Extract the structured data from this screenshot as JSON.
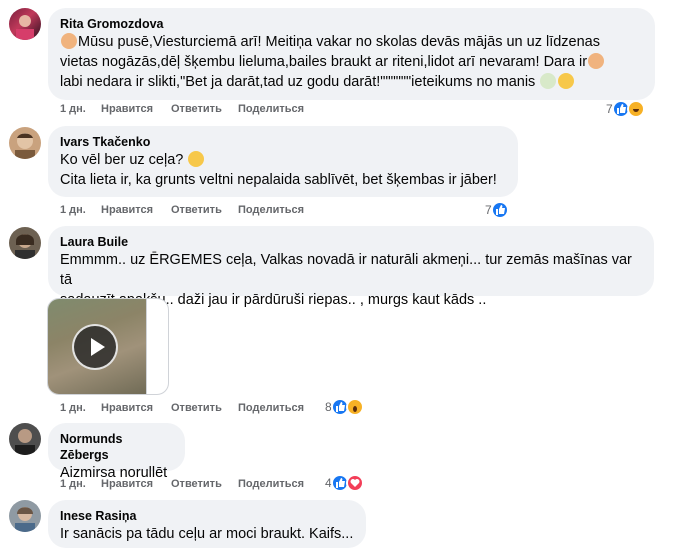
{
  "comments": [
    {
      "author": "Rita Gromozdova",
      "lines": [
        "Mūsu pusē,Viesturciemā arī! Meitiņa vakar no skolas devās mājās un uz līdzenas",
        "vietas nogāzās,dēļ šķembu lieluma,bailes braukt ar riteni,lidot arī nevaram! Dara ir",
        "labi nedara ir slikti,\"Bet ja darāt,tad uz godu darāt!\"\"\"\"\"\"ieteikums no manis"
      ],
      "time": "1 дн.",
      "like": "Нравится",
      "reply": "Ответить",
      "share": "Поделиться",
      "reaction_count": "7",
      "reactions": [
        "like-icon",
        "haha-icon"
      ]
    },
    {
      "author": "Ivars Tkačenko",
      "lines": [
        "Ko vēl ber uz ceļa?",
        "Cita lieta ir, ka grunts veltni nepalaida sablīvēt, bet šķembas ir jāber!"
      ],
      "time": "1 дн.",
      "like": "Нравится",
      "reply": "Ответить",
      "share": "Поделиться",
      "reaction_count": "7",
      "reactions": [
        "like-icon"
      ]
    },
    {
      "author": "Laura Buile",
      "lines": [
        "Emmmm.. uz ĒRGEMES ceļa, Valkas novadā ir naturāli akmeņi... tur zemās mašīnas var tā",
        "sadauzīt apakšu.. daži jau ir pārdūruši riepas.. , murgs kaut kāds .."
      ],
      "time": "1 дн.",
      "like": "Нравится",
      "reply": "Ответить",
      "share": "Поделиться",
      "reaction_count": "8",
      "reactions": [
        "like-icon",
        "wow-icon"
      ]
    },
    {
      "author": "Normunds Zēbergs",
      "lines": [
        "Aizmirsa norullēt"
      ],
      "time": "1 дн.",
      "like": "Нравится",
      "reply": "Ответить",
      "share": "Поделиться",
      "reaction_count": "4",
      "reactions": [
        "like-icon",
        "love-icon"
      ]
    },
    {
      "author": "Inese Rasiņa",
      "lines": [
        "Ir sanācis pa tādu ceļu ar moci braukt. Kaifs..."
      ]
    }
  ],
  "colors": {
    "bubble": "#f0f2f5",
    "action_text": "#65676b",
    "like_blue": "#1877f2",
    "love_red": "#f33e58",
    "emoji_yellow": "#f7b125"
  }
}
